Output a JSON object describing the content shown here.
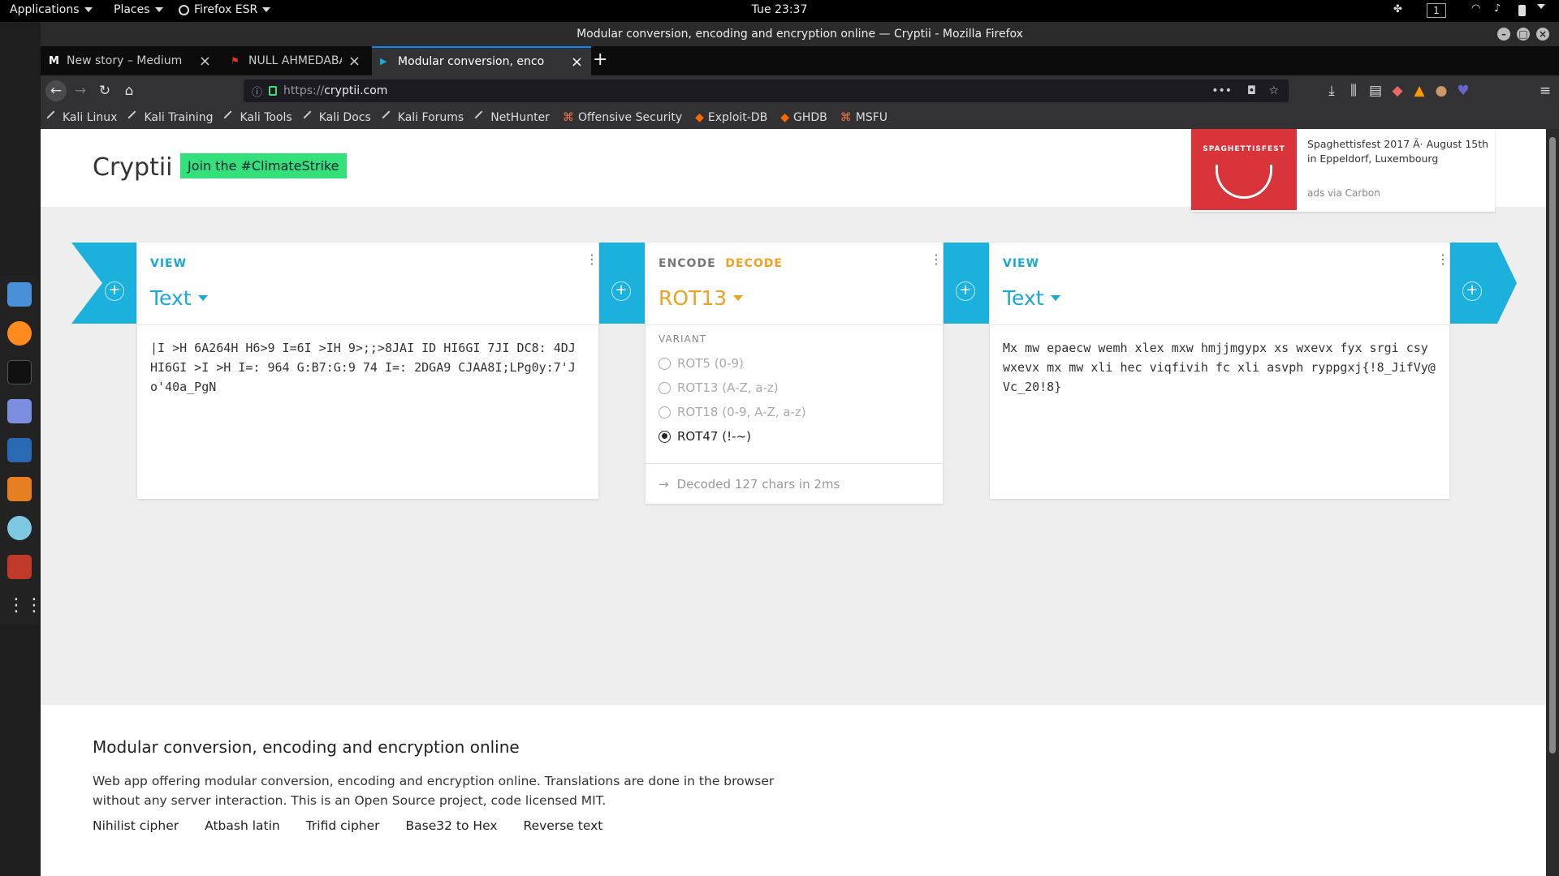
{
  "topbar": {
    "applications": "Applications",
    "places": "Places",
    "firefox": "Firefox ESR",
    "clock": "Tue 23:37",
    "workspace": "1"
  },
  "window": {
    "title": "Modular conversion, encoding and encryption online — Cryptii - Mozilla Firefox"
  },
  "tabs": [
    {
      "label": "New story – Medium",
      "favicon_color": "#ffffff",
      "favicon_glyph": "M"
    },
    {
      "label": "NULL AHMEDABAD CTF",
      "favicon_color": "#e03030",
      "favicon_glyph": "⚑"
    },
    {
      "label": "Modular conversion, enco",
      "favicon_color": "#1aa8d8",
      "favicon_glyph": "▶"
    }
  ],
  "url": {
    "scheme": "https://",
    "host": "cryptii.com"
  },
  "bookmarks": [
    "Kali Linux",
    "Kali Training",
    "Kali Tools",
    "Kali Docs",
    "Kali Forums",
    "NetHunter",
    "Offensive Security",
    "Exploit-DB",
    "GHDB",
    "MSFU"
  ],
  "site": {
    "logo": "Cryptii",
    "climate_button": "Join the #ClimateStrike",
    "ad": {
      "image_text": "SPAGHETTISFEST",
      "text": "Spaghettisfest 2017 Ã· August 15th in Eppeldorf, Luxembourg",
      "source": "ads via Carbon"
    }
  },
  "bricks": {
    "left": {
      "type": "VIEW",
      "name": "Text",
      "content": "|I >H 6A264H H6>9 I=6I >IH 9>;;>8JAI ID HI6GI 7JI DC8: 4DJ HI6GI >I >H I=: 964 G:B7:G:9 74 I=: 2DGA9 CJAA8I;LPg0y:7'Jo'40a_PgN"
    },
    "middle": {
      "encode": "ENCODE",
      "decode": "DECODE",
      "name": "ROT13",
      "variant_label": "VARIANT",
      "variants": [
        {
          "label": "ROT5 (0-9)",
          "selected": false
        },
        {
          "label": "ROT13 (A-Z, a-z)",
          "selected": false
        },
        {
          "label": "ROT18 (0-9, A-Z, a-z)",
          "selected": false
        },
        {
          "label": "ROT47 (!-~)",
          "selected": true
        }
      ],
      "status": "Decoded 127 chars in 2ms"
    },
    "right": {
      "type": "VIEW",
      "name": "Text",
      "content": "Mx mw epaecw wemh xlex mxw hmjjmgypx xs wxevx fyx srgi csy wxevx mx mw xli hec viqfivih fc xli asvph ryppgxj{!8_JifVy@Vc_20!8}"
    }
  },
  "footer": {
    "title": "Modular conversion, encoding and encryption online",
    "description": "Web app offering modular conversion, encoding and encryption online. Translations are done in the browser without any server interaction. This is an Open Source project, code licensed MIT.",
    "links": [
      "Nihilist cipher",
      "Atbash latin",
      "Trifid cipher",
      "Base32 to Hex",
      "Reverse text"
    ]
  },
  "colors": {
    "accent": "#1aa8d8",
    "decode": "#f0a020",
    "climate": "#33e07a"
  }
}
